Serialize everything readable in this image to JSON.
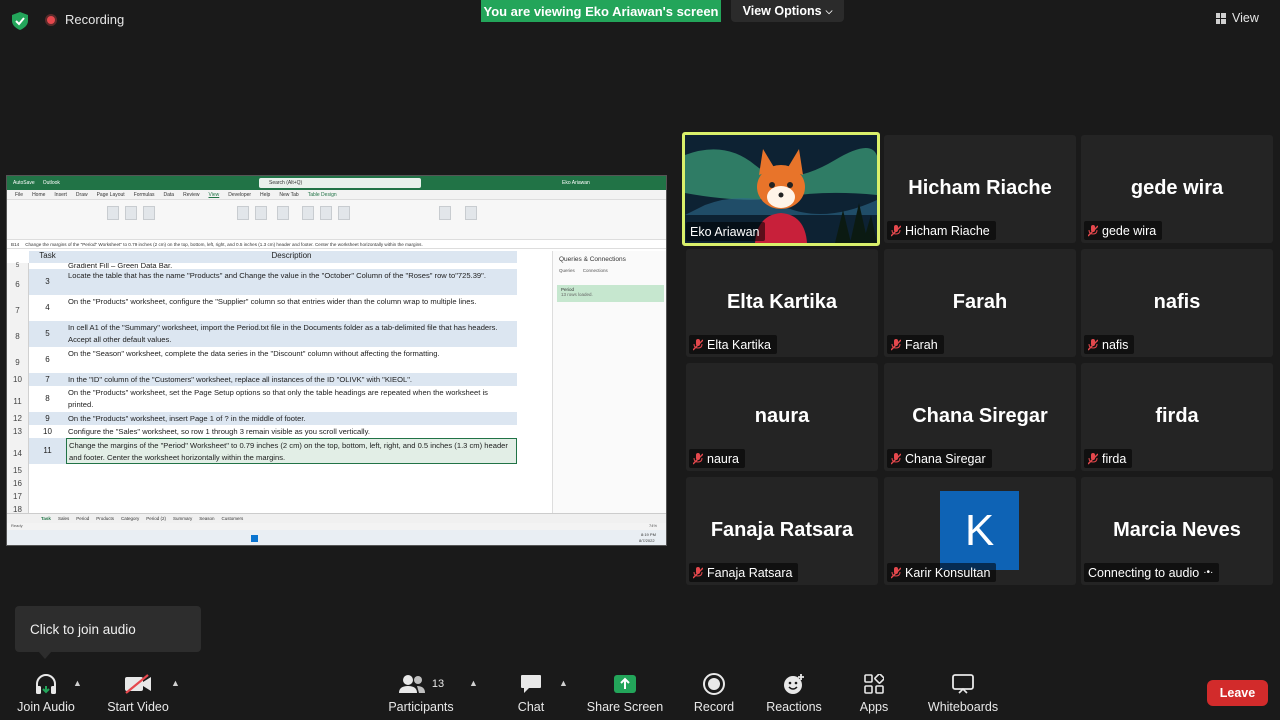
{
  "top": {
    "recording_label": "Recording",
    "viewing_banner": "You are viewing Eko Ariawan's screen",
    "view_options_label": "View Options",
    "view_label": "View"
  },
  "shared_screen": {
    "excel": {
      "autosave": "AutoSave",
      "file_label": "Outlook",
      "search_placeholder": "Search (Alt+Q)",
      "user": "Eko Ariawan",
      "menu": [
        "File",
        "Home",
        "Insert",
        "Draw",
        "Page Layout",
        "Formulas",
        "Data",
        "Review",
        "View",
        "Developer",
        "Help",
        "New Tab",
        "Table Design"
      ],
      "cell_ref": "B14",
      "formula": "Change the margins of the \"Period\" Worksheet\" to 0.79 inches (2 cm) on the top, bottom, left, right, and 0.5 inches (1.3 cm) header and footer. Center the worksheet horizontally within the margins.",
      "col_task": "Task",
      "col_desc": "Description",
      "partial_row": {
        "row": "5",
        "desc": "Gradient Fill – Green Data Bar."
      },
      "rows": [
        {
          "row": "6",
          "task": "3",
          "desc": "Locate the table that has the name \"Products\" and Change the value in the \"October\" Column of the \"Roses\" row to\"725.39\"."
        },
        {
          "row": "7",
          "task": "4",
          "desc": "On the \"Products\" worksheet, configure the \"Supplier\" column so that entries wider than the column wrap to multiple lines."
        },
        {
          "row": "8",
          "task": "5",
          "desc": "In cell A1 of the \"Summary\" worksheet, import the Period.txt file in the Documents folder as a tab-delimited file that has headers. Accept all other default values."
        },
        {
          "row": "9",
          "task": "6",
          "desc": "On the \"Season\" worksheet, complete the data series in the \"Discount\" column without affecting the formatting."
        },
        {
          "row": "10",
          "task": "7",
          "desc": "In the \"ID\" column of the \"Customers\" worksheet, replace all instances of the ID \"OLIVK\" with \"KIEOL\"."
        },
        {
          "row": "11",
          "task": "8",
          "desc": "On the \"Products\" worksheet, set the Page Setup options so that only the table headings are repeated when the worksheet is printed."
        },
        {
          "row": "12",
          "task": "9",
          "desc": "On the \"Products\" worksheet, insert Page 1 of ? in the middle of footer."
        },
        {
          "row": "13",
          "task": "10",
          "desc": "Configure the \"Sales\" worksheet, so row 1 through 3 remain visible as you scroll vertically."
        },
        {
          "row": "14",
          "task": "11",
          "desc": "Change the margins of the \"Period\" Worksheet\" to 0.79 inches (2 cm) on the top, bottom, left, right, and 0.5 inches (1.3 cm) header and footer. Center the worksheet horizontally within the margins."
        },
        {
          "row": "15",
          "task": "",
          "desc": ""
        },
        {
          "row": "16",
          "task": "",
          "desc": ""
        },
        {
          "row": "17",
          "task": "",
          "desc": ""
        },
        {
          "row": "18",
          "task": "",
          "desc": ""
        }
      ],
      "queries_title": "Queries & Connections",
      "queries_tabs": [
        "Queries",
        "Connections"
      ],
      "query_item": "Period",
      "query_status": "13 rows loaded.",
      "sheet_tabs": [
        "Task",
        "Sales",
        "Period",
        "Products",
        "Category",
        "Period (2)",
        "Summary",
        "Season",
        "Customers"
      ],
      "status": "Ready",
      "zoom": "74%",
      "time": "8:19 PM",
      "date": "8/7/2022"
    }
  },
  "participants": [
    {
      "name": "Eko Ariawan",
      "label": "Eko Ariawan",
      "muted": false,
      "video": true
    },
    {
      "name": "Hicham Riache",
      "label": "Hicham Riache",
      "muted": true
    },
    {
      "name": "gede wira",
      "label": "gede wira",
      "muted": true
    },
    {
      "name": "Elta Kartika",
      "label": "Elta Kartika",
      "muted": true
    },
    {
      "name": "Farah",
      "label": "Farah",
      "muted": true
    },
    {
      "name": "nafis",
      "label": "nafis",
      "muted": true
    },
    {
      "name": "naura",
      "label": "naura",
      "muted": true
    },
    {
      "name": "Chana Siregar",
      "label": "Chana Siregar",
      "muted": true
    },
    {
      "name": "firda",
      "label": "firda",
      "muted": true
    },
    {
      "name": "Fanaja Ratsara",
      "label": "Fanaja Ratsara",
      "muted": true
    },
    {
      "name": "K",
      "label": "Karir Konsultan",
      "muted": true,
      "avatar_color": "#0e63b5"
    },
    {
      "name": "Marcia Neves",
      "label": "Connecting to audio",
      "muted": false
    }
  ],
  "tooltip": "Click to join audio",
  "toolbar": {
    "join_audio": "Join Audio",
    "start_video": "Start Video",
    "participants": "Participants",
    "participants_count": "13",
    "chat": "Chat",
    "share_screen": "Share Screen",
    "record": "Record",
    "reactions": "Reactions",
    "apps": "Apps",
    "whiteboards": "Whiteboards",
    "leave": "Leave"
  },
  "colors": {
    "banner_green": "#23a55a",
    "share_green": "#23a55a",
    "leave_red": "#d22b2b",
    "speaker_border": "#d9f06b",
    "mute_red": "#e5484d"
  }
}
